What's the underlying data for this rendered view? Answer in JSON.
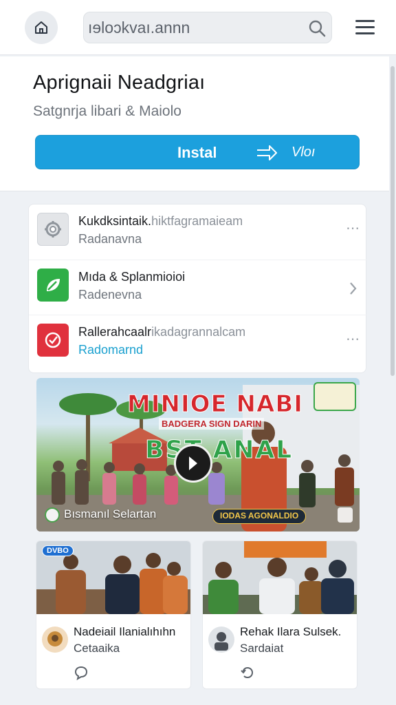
{
  "header": {
    "search": {
      "value": "ıɘloɔkvaı.annn"
    },
    "icons": {
      "home": "home-icon",
      "search": "search-icon",
      "menu": "hamburger-menu-icon"
    }
  },
  "app": {
    "title": "Aprignaii Neadgriaı",
    "subtitle": "Satgnrja libari & Maiolo",
    "install_label": "Instal",
    "install_secondary": "Vloı",
    "accent_color": "#1ca0dd"
  },
  "list": {
    "items": [
      {
        "title": "Kukdksintaik.",
        "title_muted": "hiktfagramaieam",
        "subtitle": "Radanavna",
        "icon": "gear-icon",
        "action": "more-icon"
      },
      {
        "title": "Mıda & Splanmioioi",
        "title_muted": "",
        "subtitle": "Radenevna",
        "icon": "leaf-icon",
        "action": "chevron-right-icon"
      },
      {
        "title": "Rallerahcaalr",
        "title_muted": "ikadagrannalcam",
        "subtitle": "Radomarnd",
        "icon": "record-icon",
        "action": "more-icon"
      }
    ]
  },
  "hero": {
    "headline": "MINIOE NABI",
    "subline": "BADGERA SIGN DARIN",
    "big_text": "BST ANAL",
    "caption": "Bısmanıl Selartan",
    "pill": "IODAS AGONALDIO"
  },
  "news": [
    {
      "tag": "DVBO",
      "title": "Nadeiail Ilanialıhıhn",
      "subtitle": "Cetaaika",
      "icon": "comment-icon"
    },
    {
      "tag": "",
      "title": "Rehak Ilara Sulsek.",
      "subtitle": "Sardaiat",
      "icon": "repost-icon"
    }
  ]
}
